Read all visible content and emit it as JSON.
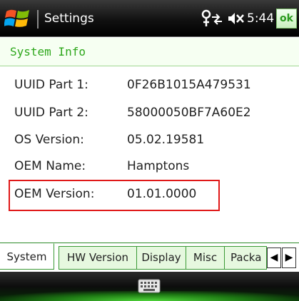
{
  "titlebar": {
    "title": "Settings",
    "time": "5:44",
    "ok_label": "ok",
    "icons": [
      "windows-logo",
      "network-connectivity-icon",
      "volume-muted-icon"
    ]
  },
  "section": {
    "title": "System Info"
  },
  "rows": [
    {
      "label": "UUID Part 1:",
      "value": "0F26B1015A479531"
    },
    {
      "label": "UUID Part 2:",
      "value": "58000050BF7A60E2"
    },
    {
      "label": "OS Version:",
      "value": "05.02.19581"
    },
    {
      "label": "OEM Name:",
      "value": "Hamptons"
    },
    {
      "label": "OEM Version:",
      "value": "01.01.0000"
    }
  ],
  "tabs": [
    {
      "label": "System",
      "active": true
    },
    {
      "label": "HW Version",
      "active": false
    },
    {
      "label": "Display",
      "active": false
    },
    {
      "label": "Misc",
      "active": false
    },
    {
      "label": "Packa",
      "active": false
    }
  ],
  "tab_arrows": {
    "left": "◀",
    "right": "▶"
  },
  "colors": {
    "accent_green": "#2da71b",
    "highlight_red": "#e01818",
    "tab_fill": "#e6f8df"
  }
}
